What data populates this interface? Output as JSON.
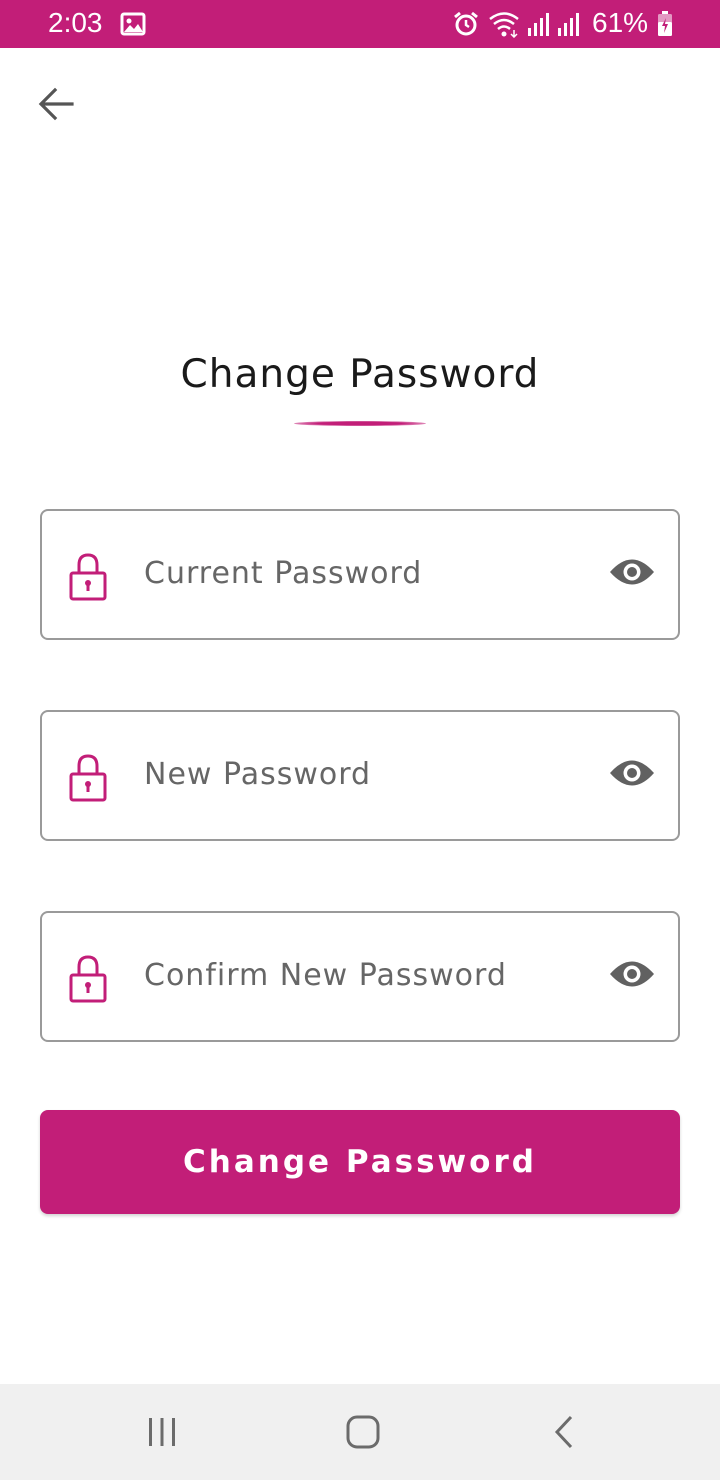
{
  "status_bar": {
    "time": "2:03",
    "battery_percent": "61%",
    "background_color": "#c21e78",
    "icons": [
      "image-icon",
      "alarm-icon",
      "wifi-icon",
      "signal-icon",
      "signal-icon",
      "battery-charging-icon"
    ]
  },
  "header": {
    "back_icon": "arrow-left-icon"
  },
  "title": "Change Password",
  "fields": [
    {
      "placeholder": "Current Password",
      "left_icon": "lock-icon",
      "right_icon": "eye-icon"
    },
    {
      "placeholder": "New Password",
      "left_icon": "lock-icon",
      "right_icon": "eye-icon"
    },
    {
      "placeholder": "Confirm New Password",
      "left_icon": "lock-icon",
      "right_icon": "eye-icon"
    }
  ],
  "submit_button": {
    "label": "Change Password"
  },
  "nav_bar": {
    "icons": [
      "recents-icon",
      "home-icon",
      "back-icon"
    ]
  },
  "colors": {
    "accent": "#c21e78",
    "border": "#9a9a9a",
    "eye": "#616161"
  }
}
